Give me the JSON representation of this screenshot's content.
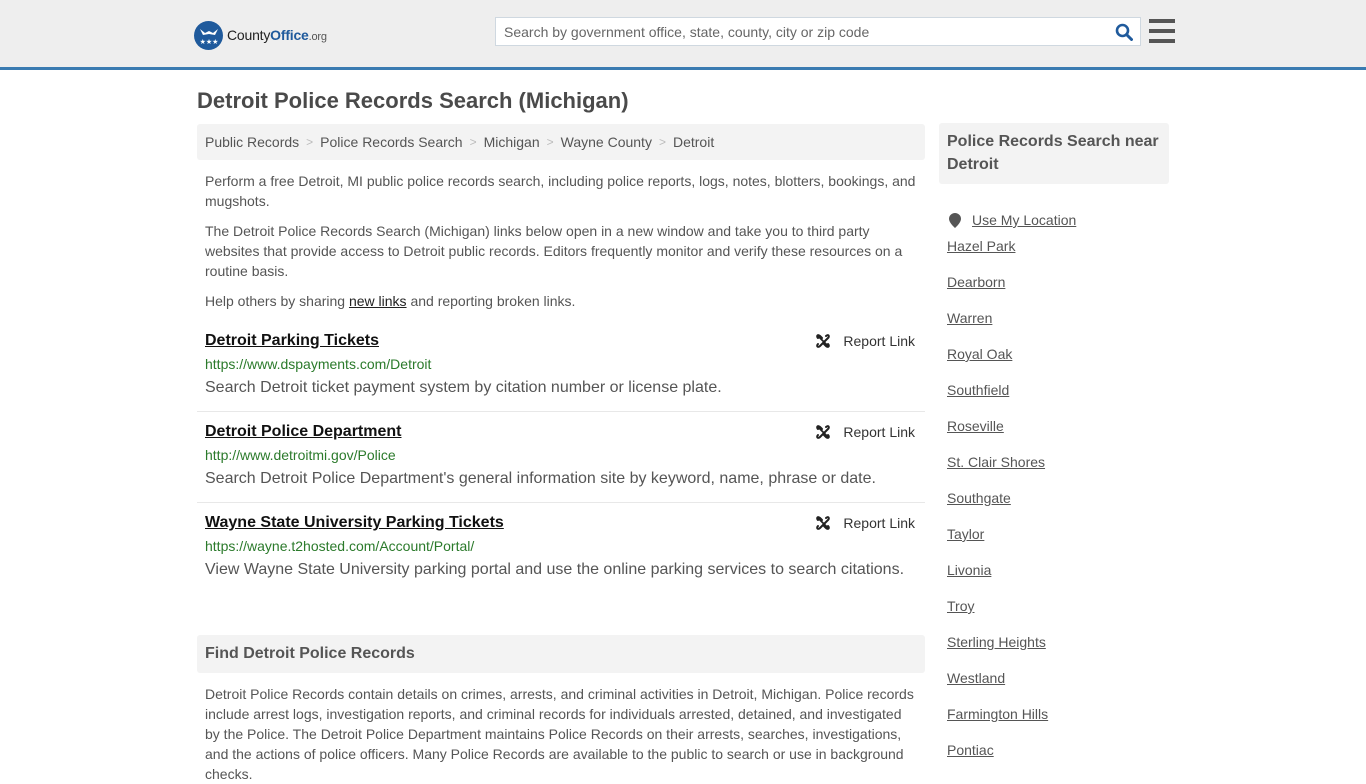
{
  "header": {
    "logo": {
      "name": "County",
      "name_bold": "Office",
      "tld": ".org"
    },
    "search": {
      "placeholder": "Search by government office, state, county, city or zip code",
      "value": ""
    },
    "colors": {
      "brand": "#1f5a9c",
      "accent_border": "#3a7bb1"
    }
  },
  "page": {
    "title": "Detroit Police Records Search (Michigan)"
  },
  "breadcrumb": [
    {
      "label": "Public Records"
    },
    {
      "label": "Police Records Search"
    },
    {
      "label": "Michigan"
    },
    {
      "label": "Wayne County"
    },
    {
      "label": "Detroit"
    }
  ],
  "breadcrumb_separator": ">",
  "intro": {
    "p1": "Perform a free Detroit, MI public police records search, including police reports, logs, notes, blotters, bookings, and mugshots.",
    "p2": "The Detroit Police Records Search (Michigan) links below open in a new window and take you to third party websites that provide access to Detroit public records. Editors frequently monitor and verify these resources on a routine basis.",
    "p3_before": "Help others by sharing ",
    "p3_link": "new links",
    "p3_after": " and reporting broken links."
  },
  "results": [
    {
      "title": "Detroit Parking Tickets",
      "url": "https://www.dspayments.com/Detroit",
      "description": "Search Detroit ticket payment system by citation number or license plate.",
      "report_label": "Report Link"
    },
    {
      "title": "Detroit Police Department",
      "url": "http://www.detroitmi.gov/Police",
      "description": "Search Detroit Police Department's general information site by keyword, name, phrase or date.",
      "report_label": "Report Link"
    },
    {
      "title": "Wayne State University Parking Tickets",
      "url": "https://wayne.t2hosted.com/Account/Portal/",
      "description": "View Wayne State University parking portal and use the online parking services to search citations.",
      "report_label": "Report Link"
    }
  ],
  "find_section": {
    "heading": "Find Detroit Police Records",
    "body": "Detroit Police Records contain details on crimes, arrests, and criminal activities in Detroit, Michigan. Police records include arrest logs, investigation reports, and criminal records for individuals arrested, detained, and investigated by the Police. The Detroit Police Department maintains Police Records on their arrests, searches, investigations, and the actions of police officers. Many Police Records are available to the public to search or use in background checks."
  },
  "sidebar": {
    "heading": "Police Records Search near Detroit",
    "use_location": "Use My Location",
    "cities": [
      "Hazel Park",
      "Dearborn",
      "Warren",
      "Royal Oak",
      "Southfield",
      "Roseville",
      "St. Clair Shores",
      "Southgate",
      "Taylor",
      "Livonia",
      "Troy",
      "Sterling Heights",
      "Westland",
      "Farmington Hills",
      "Pontiac"
    ]
  }
}
